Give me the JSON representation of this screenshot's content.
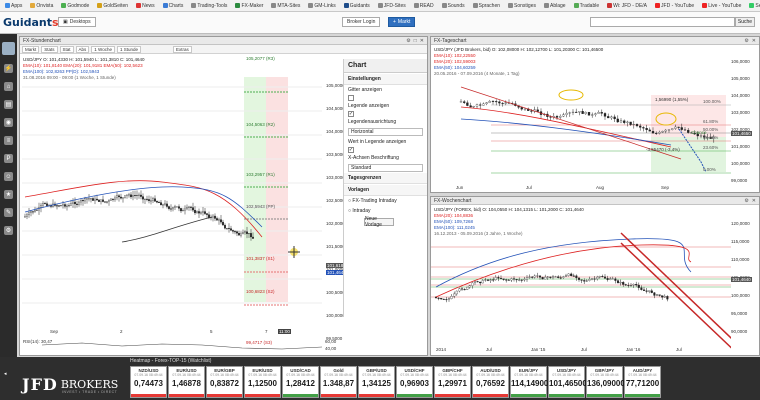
{
  "bookmarks": [
    {
      "label": "Apps",
      "color": "#3c8ae6"
    },
    {
      "label": "Onvista",
      "color": "#e2a93b"
    },
    {
      "label": "Godmode",
      "color": "#4caf50"
    },
    {
      "label": "GoldSeiten",
      "color": "#d4a017"
    },
    {
      "label": "News",
      "color": "#d33"
    },
    {
      "label": "Charts",
      "color": "#3a7bd5"
    },
    {
      "label": "Trading-Tools",
      "color": "#888"
    },
    {
      "label": "FX-Maker",
      "color": "#2b8a3e"
    },
    {
      "label": "MTA-Sites",
      "color": "#888"
    },
    {
      "label": "GM-Links",
      "color": "#888"
    },
    {
      "label": "Guidants",
      "color": "#1f4d8a"
    },
    {
      "label": "JFD-Sites",
      "color": "#888"
    },
    {
      "label": "READ",
      "color": "#888"
    },
    {
      "label": "Sounds",
      "color": "#888"
    },
    {
      "label": "Sprachen",
      "color": "#888"
    },
    {
      "label": "Sonstiges",
      "color": "#888"
    },
    {
      "label": "Ablage",
      "color": "#888"
    },
    {
      "label": "Tradable",
      "color": "#5a5"
    },
    {
      "label": "Wi: JFD - DE/A",
      "color": "#c33"
    },
    {
      "label": "JFD - YouTube",
      "color": "#e22"
    },
    {
      "label": "Live - YouTube",
      "color": "#e22"
    },
    {
      "label": "SeasonalBull",
      "color": "#3c6"
    }
  ],
  "header": {
    "logo_main": "Guidant",
    "logo_accent": "s",
    "desktops_label": "Desktops",
    "broker_login_label": "Broker Login",
    "markt_label": "Markt",
    "search_button": "Suche"
  },
  "left_panel": {
    "title": "FX-Stundenchart",
    "toolbar": [
      "1 Woche",
      "1 Stunde",
      "Extras"
    ],
    "toolbar_icons": [
      "Markt",
      "Stats",
      "Stat",
      "Abs"
    ],
    "info_line1": "USD/JPY  O: 101,4330  H: 101,5940  L: 101,3810  C: 101,4640",
    "info_ema": "EMA(10): 101,8140   EMA(20): 101,9181   EMA(50): 102,5623",
    "info_line2": "EMA(100): 102,8263   PP(D): 102,5943",
    "info_line3": "31.08.2016 09:00 - 09:00 (1 Woche, 1 Stunde)",
    "price_labels": [
      {
        "text": "105,2077 (R3)"
      },
      {
        "text": "104,5063 (R2)"
      },
      {
        "text": "103,2957 (R1)"
      },
      {
        "text": "102,5943 (PP)"
      },
      {
        "text": "101,3837 (S1)"
      },
      {
        "text": "100,6823 (S2)"
      },
      {
        "text": "99,4717 (S3)"
      }
    ],
    "yaxis": [
      "105,0000",
      "104,5000",
      "104,0000",
      "103,5000",
      "103,0000",
      "102,5000",
      "102,0000",
      "101,5000",
      "101,0000",
      "100,5000",
      "100,0000",
      "99,5000"
    ],
    "price_now": "101,6188",
    "price_now2": "101,4640",
    "xaxis": [
      "Sep",
      "2",
      "5",
      "7"
    ],
    "time_marker": "11:00",
    "rsi_label": "RSI(14): 30,47",
    "rsi_axis": [
      "60,00",
      "40,00"
    ]
  },
  "chart_sidebar": {
    "title": "Chart",
    "sec_settings": "Einstellungen",
    "grid_label": "Gitter anzeigen",
    "legend_label": "Legende anzeigen",
    "legend_align_label": "Legendenausrichtung",
    "legend_align_value": "Horizontal",
    "legend_value_label": "Wert in Legende anzeigen",
    "xaxis_label": "X-Achsen Beschriftung",
    "xaxis_value": "Standard",
    "sec_daily": "Tagesgrenzen",
    "sec_templates": "Vorlagen",
    "templates": [
      "FX-Trading Intraday",
      "Intraday"
    ],
    "new_template_btn": "Neue Vorlage"
  },
  "top_right": {
    "title": "FX-Tageschart",
    "info_line1": "USD/JPY (JFD Brokers, bid)  O: 102,08000  H: 102,12700  L: 101,20300  C: 101,46500",
    "ema1": "EMA(10): 102,22550",
    "ema2": "EMA(20): 102,59003",
    "ema3": "EMA(50): 104,60259",
    "info_line3": "20.05.2016 - 07.09.2016 (4 Monate, 1 Tag)",
    "fib_levels": [
      "100.00%",
      "61.80%",
      "50.00%",
      "38.20%",
      "23.60%",
      "0.00%"
    ],
    "annot1": "1,56990 (1,55%)",
    "annot2": "-3,55470 (-3,4%)",
    "chance_label": "Chance",
    "yaxis": [
      "106,0000",
      "105,0000",
      "104,0000",
      "103,0000",
      "102,0000",
      "101,0000",
      "100,0000",
      "99,0000"
    ],
    "price_now": "101,4650",
    "xaxis": [
      "Jun",
      "Jul",
      "Aug",
      "Sep"
    ]
  },
  "bottom_right": {
    "title": "FX-Wochenchart",
    "info_line1": "USD/JPY (FOREX, bid)  O: 104,0550  H: 104,1315  L: 101,2000  C: 101,4640",
    "ema1": "EMA(20): 104,8836",
    "ema2": "EMA(50): 109,7268",
    "ema3": "EMA(100): 111,0245",
    "info_line3": "16.12.2013 - 05.09.2016 (3 Jahre, 1 Woche)",
    "yaxis": [
      "120,0000",
      "115,0000",
      "110,0000",
      "105,0000",
      "100,0000",
      "95,0000",
      "90,0000"
    ],
    "price_now": "101,4640",
    "xaxis": [
      "2014",
      "Jul",
      "Jan '15",
      "Jul",
      "Jan '16",
      "Jul"
    ]
  },
  "footer": {
    "title": "Heatmap - Forex-TOP-15 (Watchlist)",
    "brand": "JFD",
    "brand2": "BROKERS",
    "brand_tag": "INVEST • TRADE • DIRECT",
    "tickers": [
      {
        "name": "NZD/USD",
        "time": "07.09.16 08:49:44",
        "price": "0,74473",
        "color": "#e53935"
      },
      {
        "name": "EUR/USD",
        "time": "07.09.16 08:49:44",
        "price": "1,46878",
        "color": "#e53935"
      },
      {
        "name": "EUR/GBP",
        "time": "07.09.16 08:49:44",
        "price": "0,83872",
        "color": "#e53935"
      },
      {
        "name": "EUR/USD",
        "time": "07.09.16 08:49:44",
        "price": "1,12500",
        "color": "#e53935"
      },
      {
        "name": "USD/CAD",
        "time": "07.09.16 08:49:44",
        "price": "1,28412",
        "color": "#43a047"
      },
      {
        "name": "Gold",
        "time": "07.09.16 08:49:44",
        "price": "1.348,87",
        "color": "#e53935"
      },
      {
        "name": "GBP/USD",
        "time": "07.09.16 08:49:44",
        "price": "1,34125",
        "color": "#e53935"
      },
      {
        "name": "USD/CHF",
        "time": "07.09.16 08:49:44",
        "price": "0,96903",
        "color": "#43a047"
      },
      {
        "name": "GBP/CHF",
        "time": "07.09.16 08:49:44",
        "price": "1,29971",
        "color": "#e53935"
      },
      {
        "name": "AUD/USD",
        "time": "07.09.16 08:49:44",
        "price": "0,76592",
        "color": "#e53935"
      },
      {
        "name": "EUR/JPY",
        "time": "07.09.16 08:49:44",
        "price": "114,14900",
        "color": "#43a047"
      },
      {
        "name": "USD/JPY",
        "time": "07.09.16 08:49:44",
        "price": "101,46500",
        "color": "#43a047"
      },
      {
        "name": "GBP/JPY",
        "time": "07.09.16 08:49:44",
        "price": "136,09000",
        "color": "#43a047"
      },
      {
        "name": "AUD/JPY",
        "time": "07.09.16 08:49:44",
        "price": "77,71200",
        "color": "#43a047"
      }
    ]
  }
}
